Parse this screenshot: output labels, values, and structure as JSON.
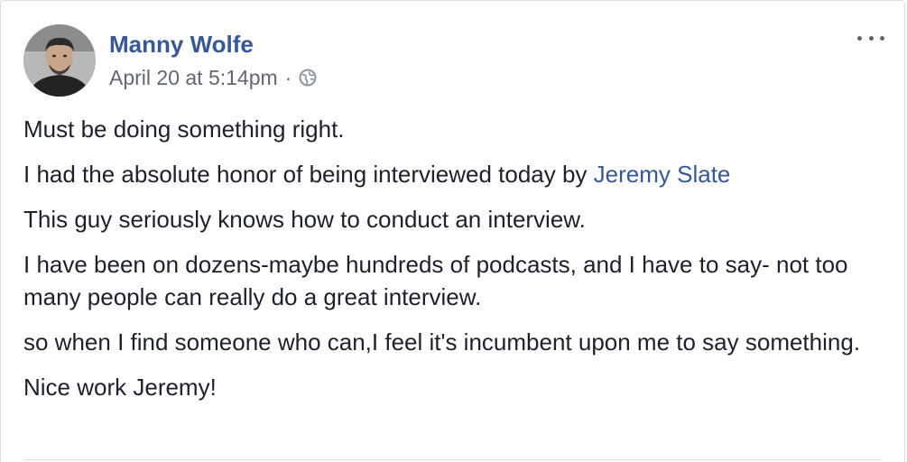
{
  "post": {
    "author": "Manny Wolfe",
    "timestamp": "April 20 at 5:14pm",
    "separator": "·",
    "privacy_icon": "globe-icon",
    "menu_icon": "more-options-icon",
    "paragraphs": {
      "p1": "Must be doing something right.",
      "p2_text": "I had the absolute honor of being interviewed today by ",
      "p2_mention": "Jeremy Slate",
      "p3": "This guy seriously knows how to conduct an interview.",
      "p4": "I have been on dozens-maybe hundreds of podcasts, and I have to say- not too many people can really do a great interview.",
      "p5": "so when I find someone who can,I feel it's incumbent upon me to say something.",
      "p6": "Nice work Jeremy!"
    }
  },
  "colors": {
    "link": "#365899",
    "text": "#1d2129",
    "meta": "#616770",
    "border": "#dddfe2"
  }
}
